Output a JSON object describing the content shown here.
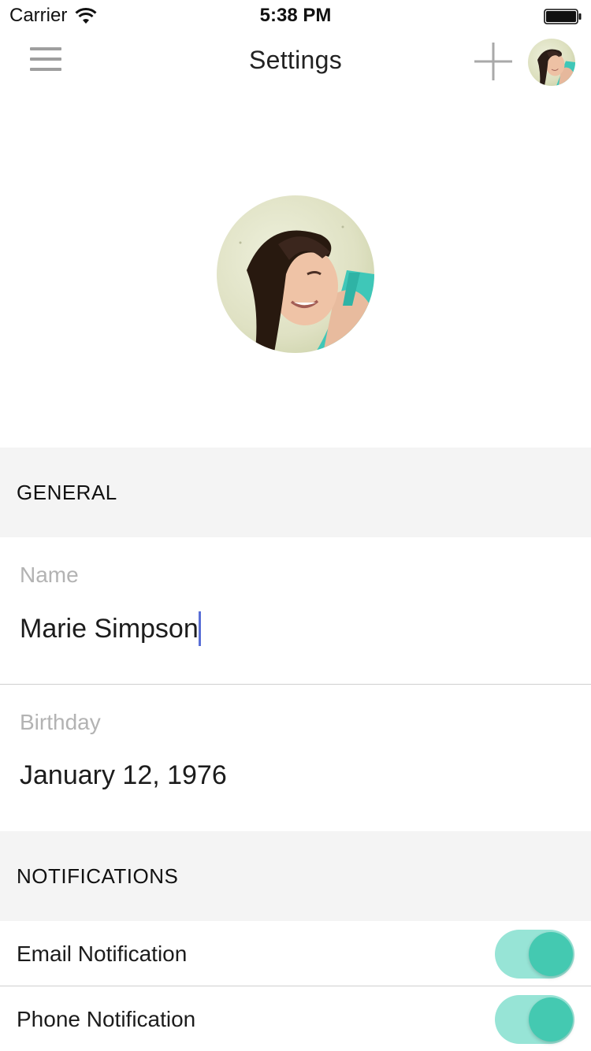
{
  "status_bar": {
    "carrier": "Carrier",
    "time": "5:38 PM",
    "wifi_icon": "wifi-icon",
    "battery_icon": "battery-icon"
  },
  "nav": {
    "title": "Settings",
    "menu_icon": "hamburger-menu-icon",
    "add_icon": "plus-icon",
    "avatar": "user-avatar"
  },
  "profile": {
    "photo": "profile-photo"
  },
  "general": {
    "header": "GENERAL",
    "name_label": "Name",
    "name_value": "Marie Simpson",
    "birthday_label": "Birthday",
    "birthday_value": "January 12, 1976"
  },
  "notifications": {
    "header": "NOTIFICATIONS",
    "items": [
      {
        "label": "Email Notification",
        "enabled": true
      },
      {
        "label": "Phone Notification",
        "enabled": true
      }
    ]
  },
  "colors": {
    "accent": "#44c9b1",
    "toggle_track": "#97e4d6",
    "section_bg": "#f4f4f4",
    "caret": "#5a6fd6"
  }
}
